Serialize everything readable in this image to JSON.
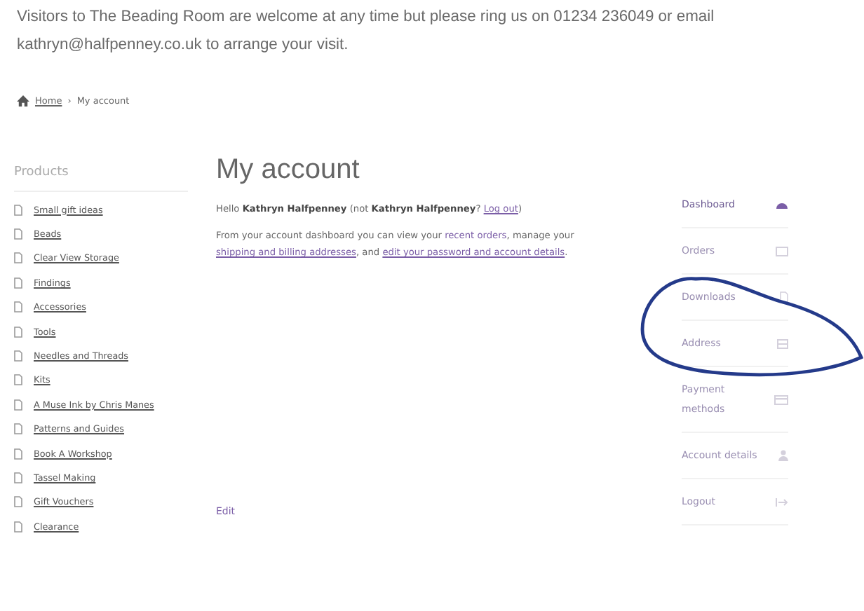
{
  "notice": [
    "Visitors to The Beading Room are welcome at any time but please ring us on 01234 236049 or email",
    "kathryn@halfpenney.co.uk to arrange your visit."
  ],
  "breadcrumb": [
    {
      "label": "Home",
      "link": true
    },
    {
      "label": "›",
      "link": false
    },
    {
      "label": "My account",
      "link": false
    }
  ],
  "sidebar": {
    "title": "Products",
    "items": [
      "Small gift ideas",
      "Beads",
      "Clear View Storage",
      "Findings",
      "Accessories",
      "Tools",
      "Needles and Threads",
      "Kits",
      "A Muse Ink by Chris Manes",
      "Patterns and Guides",
      "Book A Workshop",
      "Tassel Making",
      "Gift Vouchers",
      "Clearance"
    ]
  },
  "main": {
    "title": "My account",
    "greeting": [
      {
        "text": "Hello **Kathryn Halfpenney** (not **Kathryn Halfpenney**? ",
        "link": false
      },
      {
        "text": "Log out",
        "link": true
      },
      {
        "text": ")",
        "link": false
      }
    ],
    "intro": [
      {
        "text": "From your account dashboard you can view your ",
        "link": false
      },
      {
        "text": "recent orders",
        "link": true,
        "underline": false
      },
      {
        "text": ", manage your ",
        "link": false
      },
      {
        "text": "shipping and billing addresses",
        "link": true,
        "underline": true
      },
      {
        "text": ", and ",
        "link": false
      },
      {
        "text": "edit your password and account details",
        "link": true,
        "underline": true
      },
      {
        "text": ".",
        "link": false
      }
    ],
    "edit_link": "Edit"
  },
  "account_nav": [
    {
      "label": "Dashboard",
      "kind": "dashboard",
      "selected": true
    },
    {
      "label": "Orders",
      "kind": "orders",
      "selected": false
    },
    {
      "label": "Downloads",
      "kind": "downloads",
      "selected": false
    },
    {
      "label": "Address",
      "kind": "address",
      "selected": false
    },
    {
      "label": "Payment methods",
      "kind": "payment",
      "selected": false
    },
    {
      "label": "Account details",
      "kind": "user",
      "selected": false
    },
    {
      "label": "Logout",
      "kind": "logout",
      "selected": false
    }
  ]
}
